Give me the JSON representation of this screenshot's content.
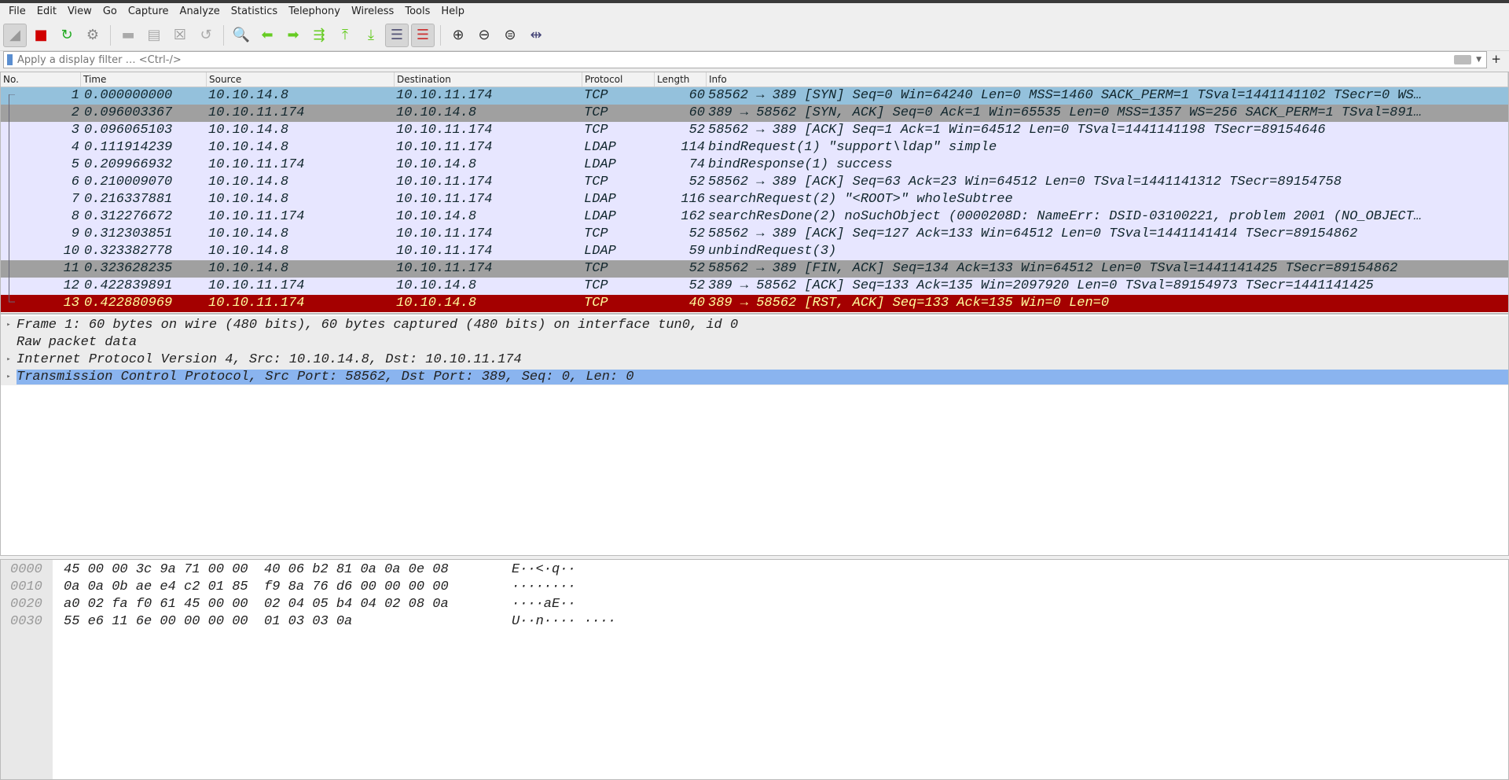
{
  "menu": [
    "File",
    "Edit",
    "View",
    "Go",
    "Capture",
    "Analyze",
    "Statistics",
    "Telephony",
    "Wireless",
    "Tools",
    "Help"
  ],
  "toolbar": [
    {
      "icon": "shark-fin-start-icon",
      "glyph": "◢",
      "color": "#999"
    },
    {
      "icon": "stop-capture-icon",
      "glyph": "■",
      "color": "#d00000"
    },
    {
      "icon": "restart-capture-icon",
      "glyph": "↻",
      "color": "#2a2"
    },
    {
      "icon": "capture-options-icon",
      "glyph": "⚙",
      "color": "#888"
    },
    {
      "icon": "open-file-icon",
      "glyph": "▬",
      "color": "#aaa"
    },
    {
      "icon": "save-file-icon",
      "glyph": "▤",
      "color": "#aaa"
    },
    {
      "icon": "close-file-icon",
      "glyph": "☒",
      "color": "#999"
    },
    {
      "icon": "reload-file-icon",
      "glyph": "↺",
      "color": "#aaa"
    },
    {
      "icon": "find-packet-icon",
      "glyph": "🔍",
      "color": "#333"
    },
    {
      "icon": "go-back-icon",
      "glyph": "⬅",
      "color": "#6c2"
    },
    {
      "icon": "go-forward-icon",
      "glyph": "➡",
      "color": "#6c2"
    },
    {
      "icon": "go-to-packet-icon",
      "glyph": "⇶",
      "color": "#6c2"
    },
    {
      "icon": "first-packet-icon",
      "glyph": "⤒",
      "color": "#6c2"
    },
    {
      "icon": "last-packet-icon",
      "glyph": "⤓",
      "color": "#6c2"
    },
    {
      "icon": "autoscroll-icon",
      "glyph": "☰",
      "color": "#557"
    },
    {
      "icon": "colorize-icon",
      "glyph": "☰",
      "color": "#c33"
    },
    {
      "icon": "zoom-in-icon",
      "glyph": "⊕",
      "color": "#333"
    },
    {
      "icon": "zoom-out-icon",
      "glyph": "⊖",
      "color": "#333"
    },
    {
      "icon": "zoom-normal-icon",
      "glyph": "⊜",
      "color": "#333"
    },
    {
      "icon": "resize-columns-icon",
      "glyph": "⇹",
      "color": "#447"
    }
  ],
  "filter": {
    "placeholder": "Apply a display filter … <Ctrl-/>",
    "add_label": "+"
  },
  "columns": [
    "No.",
    "Time",
    "Source",
    "Destination",
    "Protocol",
    "Length",
    "Info"
  ],
  "packets": [
    {
      "no": "1",
      "time": "0.000000000",
      "src": "10.10.14.8",
      "dst": "10.10.11.174",
      "proto": "TCP",
      "len": "60",
      "info": "58562 → 389 [SYN] Seq=0 Win=64240 Len=0 MSS=1460 SACK_PERM=1 TSval=1441141102 TSecr=0 WS…",
      "style": "sel"
    },
    {
      "no": "2",
      "time": "0.096003367",
      "src": "10.10.11.174",
      "dst": "10.10.14.8",
      "proto": "TCP",
      "len": "60",
      "info": "389 → 58562 [SYN, ACK] Seq=0 Ack=1 Win=65535 Len=0 MSS=1357 WS=256 SACK_PERM=1 TSval=891…",
      "style": "gray"
    },
    {
      "no": "3",
      "time": "0.096065103",
      "src": "10.10.14.8",
      "dst": "10.10.11.174",
      "proto": "TCP",
      "len": "52",
      "info": "58562 → 389 [ACK] Seq=1 Ack=1 Win=64512 Len=0 TSval=1441141198 TSecr=89154646",
      "style": ""
    },
    {
      "no": "4",
      "time": "0.111914239",
      "src": "10.10.14.8",
      "dst": "10.10.11.174",
      "proto": "LDAP",
      "len": "114",
      "info": "bindRequest(1) \"support\\ldap\" simple",
      "style": ""
    },
    {
      "no": "5",
      "time": "0.209966932",
      "src": "10.10.11.174",
      "dst": "10.10.14.8",
      "proto": "LDAP",
      "len": "74",
      "info": "bindResponse(1) success",
      "style": ""
    },
    {
      "no": "6",
      "time": "0.210009070",
      "src": "10.10.14.8",
      "dst": "10.10.11.174",
      "proto": "TCP",
      "len": "52",
      "info": "58562 → 389 [ACK] Seq=63 Ack=23 Win=64512 Len=0 TSval=1441141312 TSecr=89154758",
      "style": ""
    },
    {
      "no": "7",
      "time": "0.216337881",
      "src": "10.10.14.8",
      "dst": "10.10.11.174",
      "proto": "LDAP",
      "len": "116",
      "info": "searchRequest(2) \"<ROOT>\" wholeSubtree",
      "style": ""
    },
    {
      "no": "8",
      "time": "0.312276672",
      "src": "10.10.11.174",
      "dst": "10.10.14.8",
      "proto": "LDAP",
      "len": "162",
      "info": "searchResDone(2) noSuchObject (0000208D: NameErr: DSID-03100221, problem 2001 (NO_OBJECT…",
      "style": ""
    },
    {
      "no": "9",
      "time": "0.312303851",
      "src": "10.10.14.8",
      "dst": "10.10.11.174",
      "proto": "TCP",
      "len": "52",
      "info": "58562 → 389 [ACK] Seq=127 Ack=133 Win=64512 Len=0 TSval=1441141414 TSecr=89154862",
      "style": ""
    },
    {
      "no": "10",
      "time": "0.323382778",
      "src": "10.10.14.8",
      "dst": "10.10.11.174",
      "proto": "LDAP",
      "len": "59",
      "info": "unbindRequest(3)",
      "style": ""
    },
    {
      "no": "11",
      "time": "0.323628235",
      "src": "10.10.14.8",
      "dst": "10.10.11.174",
      "proto": "TCP",
      "len": "52",
      "info": "58562 → 389 [FIN, ACK] Seq=134 Ack=133 Win=64512 Len=0 TSval=1441141425 TSecr=89154862",
      "style": "gray"
    },
    {
      "no": "12",
      "time": "0.422839891",
      "src": "10.10.11.174",
      "dst": "10.10.14.8",
      "proto": "TCP",
      "len": "52",
      "info": "389 → 58562 [ACK] Seq=133 Ack=135 Win=2097920 Len=0 TSval=89154973 TSecr=1441141425",
      "style": ""
    },
    {
      "no": "13",
      "time": "0.422880969",
      "src": "10.10.11.174",
      "dst": "10.10.14.8",
      "proto": "TCP",
      "len": "40",
      "info": "389 → 58562 [RST, ACK] Seq=133 Ack=135 Win=0 Len=0",
      "style": "red"
    }
  ],
  "details": [
    {
      "text": "Frame 1: 60 bytes on wire (480 bits), 60 bytes captured (480 bits) on interface tun0, id 0",
      "expandable": true,
      "selected": false
    },
    {
      "text": "Raw packet data",
      "expandable": false,
      "selected": false
    },
    {
      "text": "Internet Protocol Version 4, Src: 10.10.14.8, Dst: 10.10.11.174",
      "expandable": true,
      "selected": false
    },
    {
      "text": "Transmission Control Protocol, Src Port: 58562, Dst Port: 389, Seq: 0, Len: 0",
      "expandable": true,
      "selected": true
    }
  ],
  "hex": [
    {
      "offset": "0000",
      "bytes": "45 00 00 3c 9a 71 00 00  40 06 b2 81 0a 0a 0e 08",
      "ascii": "E··<·q··"
    },
    {
      "offset": "0010",
      "bytes": "0a 0a 0b ae e4 c2 01 85  f9 8a 76 d6 00 00 00 00",
      "ascii": "········"
    },
    {
      "offset": "0020",
      "bytes": "a0 02 fa f0 61 45 00 00  02 04 05 b4 04 02 08 0a",
      "ascii": "····aE··"
    },
    {
      "offset": "0030",
      "bytes": "55 e6 11 6e 00 00 00 00  01 03 03 0a",
      "ascii": "U··n···· ····"
    }
  ]
}
